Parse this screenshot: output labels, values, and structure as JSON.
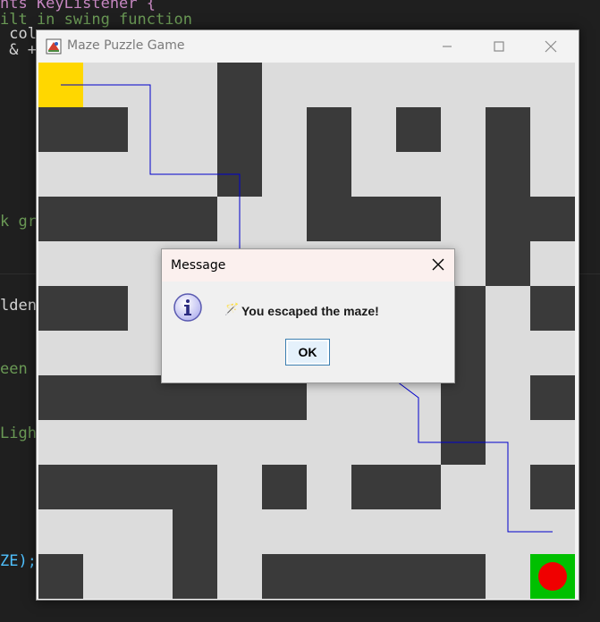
{
  "editor": {
    "lines": [
      {
        "text": "nts KeyListener {",
        "style": "kw"
      },
      {
        "text": "ilt in swing function",
        "style": "comment"
      },
      {
        "text": " col",
        "style": "white"
      },
      {
        "text": " & +",
        "style": "white"
      },
      {
        "text": "k gra",
        "style": "comment"
      },
      {
        "text": "lden",
        "style": "comment"
      },
      {
        "text": "een",
        "style": "comment"
      },
      {
        "text": "Light",
        "style": "comment"
      },
      {
        "text": "ZE);",
        "style": "ident"
      }
    ]
  },
  "window": {
    "title": "Maze Puzzle Game",
    "icon": "java-app-icon",
    "controls": [
      "minimize-icon",
      "maximize-icon",
      "close-icon"
    ]
  },
  "maze": {
    "grid_size": 12,
    "wall_color": "#3a3a3a",
    "floor_color": "#dcdcdc",
    "start_color": "#ffd700",
    "goal_color": "#00c000",
    "player_color": "#f00000",
    "path_color": "#0000cc",
    "rows": [
      "S...#.......",
      "##..#.#.#.#.",
      "....#.#...#.",
      "####..###.##",
      "..........#.",
      "##.......#.#",
      ".........#..",
      "######...#.#",
      ".........#..",
      "####.#.##..#",
      "...#........",
      "#..#.#####.G"
    ],
    "solution_path": [
      [
        0.5,
        0.5
      ],
      [
        2.5,
        0.5
      ],
      [
        2.5,
        2.5
      ],
      [
        4.5,
        2.5
      ],
      [
        4.5,
        4.5
      ],
      [
        8.5,
        8.5
      ],
      [
        8.5,
        8.5
      ],
      [
        10.5,
        8.5
      ],
      [
        10.5,
        10.5
      ],
      [
        11.5,
        10.5
      ]
    ]
  },
  "dialog": {
    "title": "Message",
    "message": "You escaped the maze!",
    "emoji": "🪄",
    "ok_label": "OK"
  }
}
